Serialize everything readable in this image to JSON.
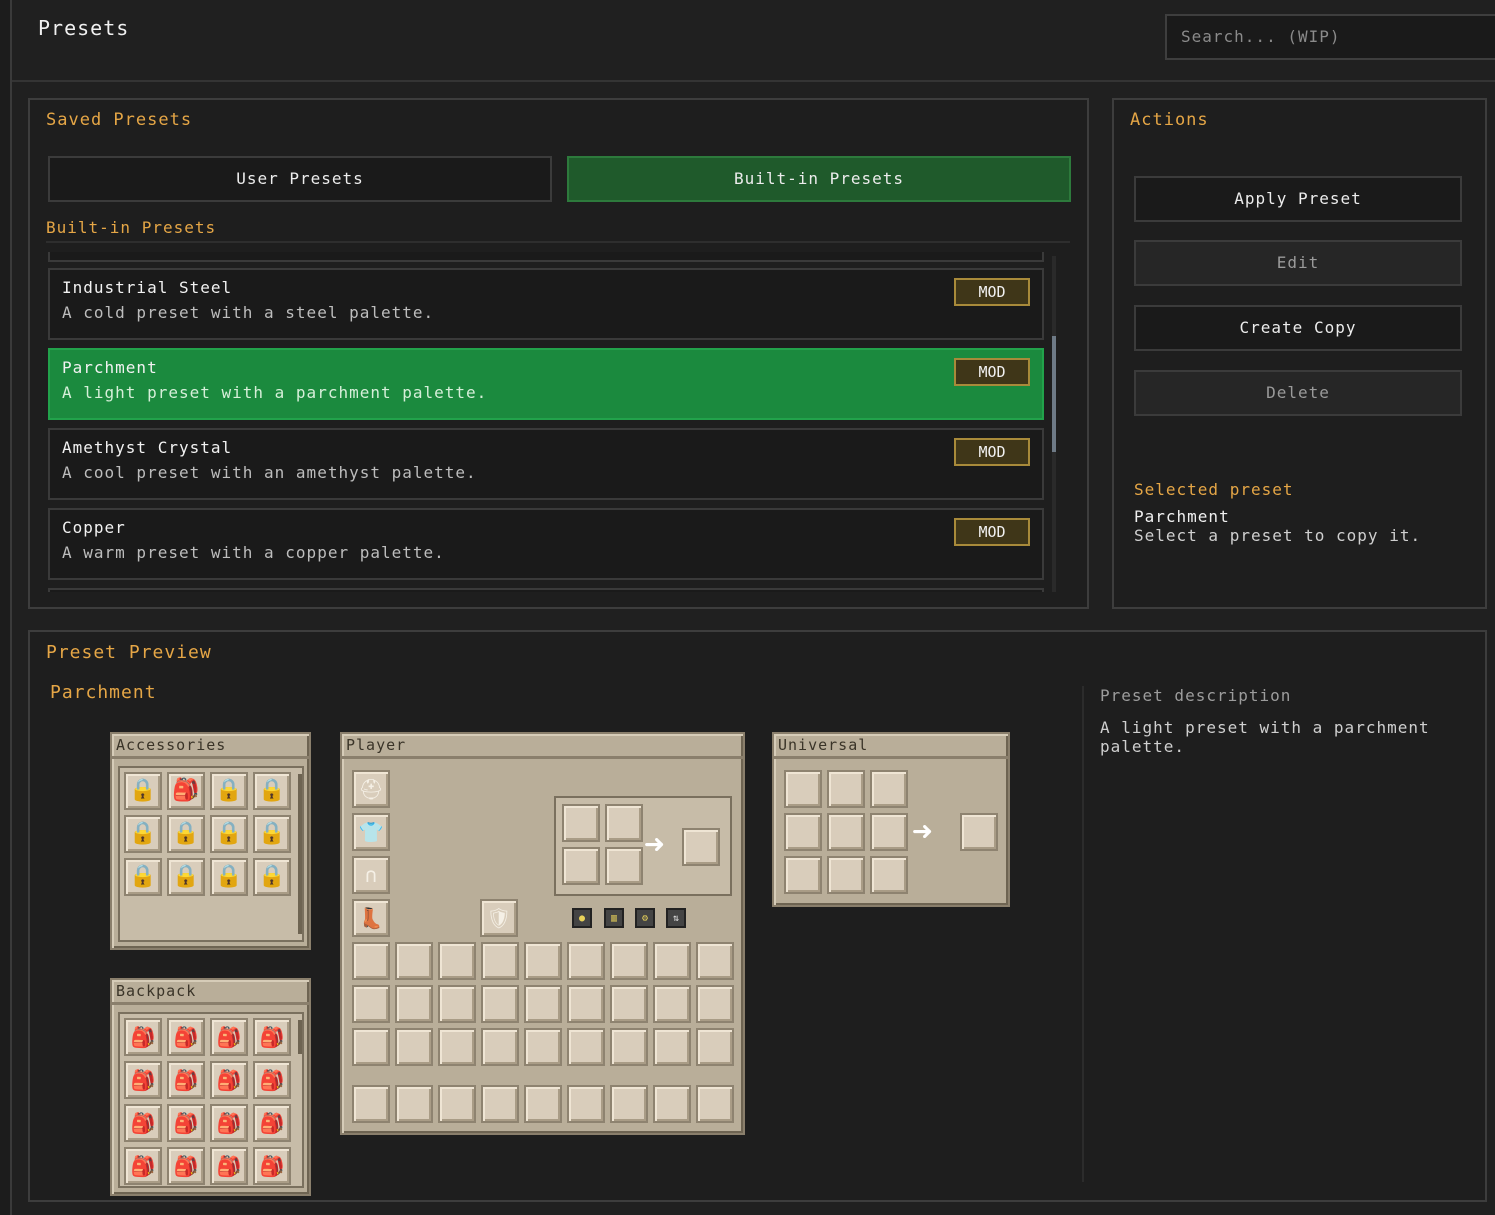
{
  "window": {
    "title": "Presets"
  },
  "search": {
    "placeholder": "Search... (WIP)"
  },
  "saved": {
    "title": "Saved Presets",
    "tabs": [
      {
        "label": "User Presets",
        "active": false
      },
      {
        "label": "Built-in Presets",
        "active": true
      }
    ],
    "list_title": "Built-in Presets",
    "items": [
      {
        "name": "Industrial Steel",
        "desc": "A cold preset with a steel palette.",
        "badge": "MOD",
        "selected": false
      },
      {
        "name": "Parchment",
        "desc": "A light preset with a parchment palette.",
        "badge": "MOD",
        "selected": true
      },
      {
        "name": "Amethyst Crystal",
        "desc": "A cool preset with an amethyst palette.",
        "badge": "MOD",
        "selected": false
      },
      {
        "name": "Copper",
        "desc": "A warm preset with a copper palette.",
        "badge": "MOD",
        "selected": false
      }
    ]
  },
  "actions": {
    "title": "Actions",
    "buttons": [
      {
        "label": "Apply Preset",
        "enabled": true
      },
      {
        "label": "Edit",
        "enabled": false
      },
      {
        "label": "Create Copy",
        "enabled": true
      },
      {
        "label": "Delete",
        "enabled": false
      }
    ],
    "selected_label": "Selected preset",
    "selected_name": "Parchment",
    "selected_hint": "Select a preset to copy it."
  },
  "preview": {
    "title": "Preset Preview",
    "preset_name": "Parchment",
    "description_label": "Preset description",
    "description": "A light preset with a parchment palette.",
    "screens": {
      "accessories": "Accessories",
      "backpack": "Backpack",
      "player": "Player",
      "universal": "Universal"
    }
  },
  "colors": {
    "accent": "#e5a646",
    "tab_active": "#1f5a2b",
    "item_selected": "#1b8a3e",
    "badge_bg": "#3f3618",
    "parchment": "#b9ae99"
  }
}
